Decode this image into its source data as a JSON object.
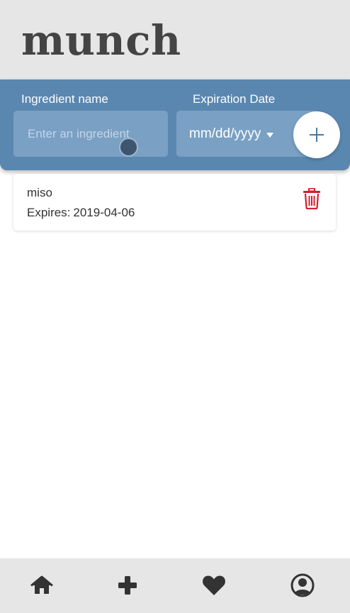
{
  "header": {
    "title": "munch"
  },
  "form": {
    "name_label": "Ingredient name",
    "name_placeholder": "Enter an ingredient",
    "date_label": "Expiration Date",
    "date_placeholder": "mm/dd/yyyy"
  },
  "ingredients": [
    {
      "name": "miso",
      "expires_label": "Expires:",
      "expires": "2019-04-06"
    }
  ],
  "bottom_nav": {
    "items": [
      {
        "icon": "home-icon"
      },
      {
        "icon": "plus-icon"
      },
      {
        "icon": "heart-icon"
      },
      {
        "icon": "user-circle-icon"
      }
    ]
  },
  "colors": {
    "accent": "#5987b0",
    "input_bg": "#7aa0c4",
    "header_bg": "#e6e6e6",
    "delete": "#d0202e",
    "nav_icon": "#333333"
  }
}
